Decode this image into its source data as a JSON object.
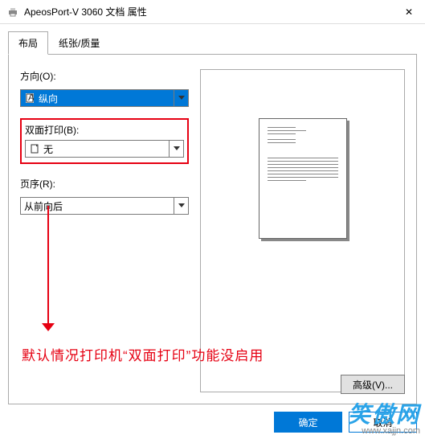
{
  "window": {
    "title": "ApeosPort-V 3060 文档 属性",
    "close_symbol": "✕"
  },
  "tabs": {
    "layout": "布局",
    "paper": "纸张/质量"
  },
  "form": {
    "orientation_label": "方向(O):",
    "orientation_value": "纵向",
    "duplex_label": "双面打印(B):",
    "duplex_value": "无",
    "order_label": "页序(R):",
    "order_value": "从前向后",
    "advanced_button": "高级(V)..."
  },
  "annotation": "默认情况打印机“双面打印”功能没启用",
  "footer": {
    "ok": "确定",
    "cancel": "取消"
  },
  "watermark": {
    "brand": "笑傲网",
    "url": "www.xajjn.com"
  }
}
